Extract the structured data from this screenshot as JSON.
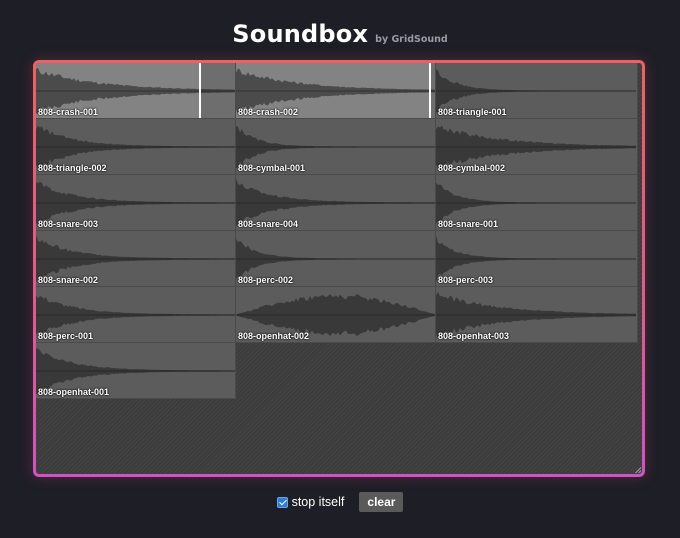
{
  "header": {
    "title": "Soundbox",
    "byline": "by GridSound"
  },
  "pads": [
    {
      "label": "808-crash-001",
      "active": true,
      "progress": 0.82,
      "env": "long"
    },
    {
      "label": "808-crash-002",
      "active": true,
      "progress": 0.97,
      "env": "long"
    },
    {
      "label": "808-triangle-001",
      "active": false,
      "progress": 0,
      "env": "short"
    },
    {
      "label": "808-triangle-002",
      "active": false,
      "progress": 0,
      "env": "mid"
    },
    {
      "label": "808-cymbal-001",
      "active": false,
      "progress": 0,
      "env": "short"
    },
    {
      "label": "808-cymbal-002",
      "active": false,
      "progress": 0,
      "env": "long"
    },
    {
      "label": "808-snare-003",
      "active": false,
      "progress": 0,
      "env": "mid"
    },
    {
      "label": "808-snare-004",
      "active": false,
      "progress": 0,
      "env": "mid"
    },
    {
      "label": "808-snare-001",
      "active": false,
      "progress": 0,
      "env": "short"
    },
    {
      "label": "808-snare-002",
      "active": false,
      "progress": 0,
      "env": "mid"
    },
    {
      "label": "808-perc-002",
      "active": false,
      "progress": 0,
      "env": "short"
    },
    {
      "label": "808-perc-003",
      "active": false,
      "progress": 0,
      "env": "short"
    },
    {
      "label": "808-perc-001",
      "active": false,
      "progress": 0,
      "env": "mid"
    },
    {
      "label": "808-openhat-002",
      "active": false,
      "progress": 0,
      "env": "swell"
    },
    {
      "label": "808-openhat-003",
      "active": false,
      "progress": 0,
      "env": "long"
    },
    {
      "label": "808-openhat-001",
      "active": false,
      "progress": 0,
      "env": "mid"
    }
  ],
  "controls": {
    "stop_itself_label": "stop itself",
    "stop_itself_checked": true,
    "clear_label": "clear"
  },
  "colors": {
    "background": "#1e1e26",
    "panel_border_top": "#f0605f",
    "panel_border_bottom": "#d052c8",
    "pad": "#5c5c5c",
    "checkbox": "#2f7bd8"
  }
}
